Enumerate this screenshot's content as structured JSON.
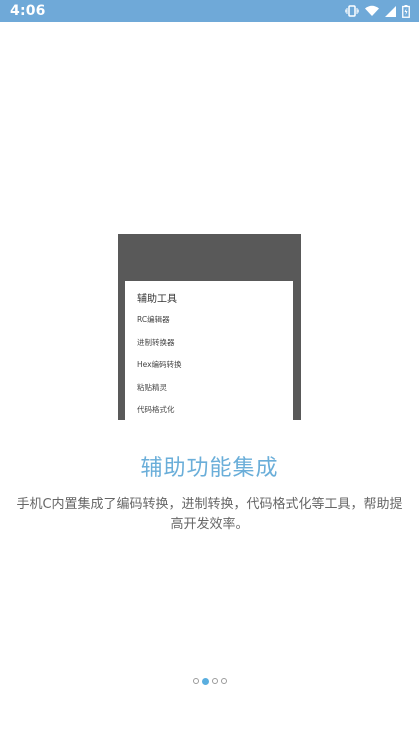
{
  "status_bar": {
    "time": "4:06",
    "icons": [
      "vibrate-icon",
      "wifi-icon",
      "signal-icon",
      "battery-icon"
    ],
    "color": "#6fa9d8"
  },
  "preview": {
    "title": "辅助工具",
    "items": [
      "RC编辑器",
      "进制转换器",
      "Hex编码转换",
      "粘贴精灵",
      "代码格式化"
    ]
  },
  "feature": {
    "title": "辅助功能集成",
    "description": "手机C内置集成了编码转换，进制转换，代码格式化等工具，帮助提高开发效率。",
    "accent_color": "#6aaed9"
  },
  "pager": {
    "count": 4,
    "active_index": 1
  }
}
